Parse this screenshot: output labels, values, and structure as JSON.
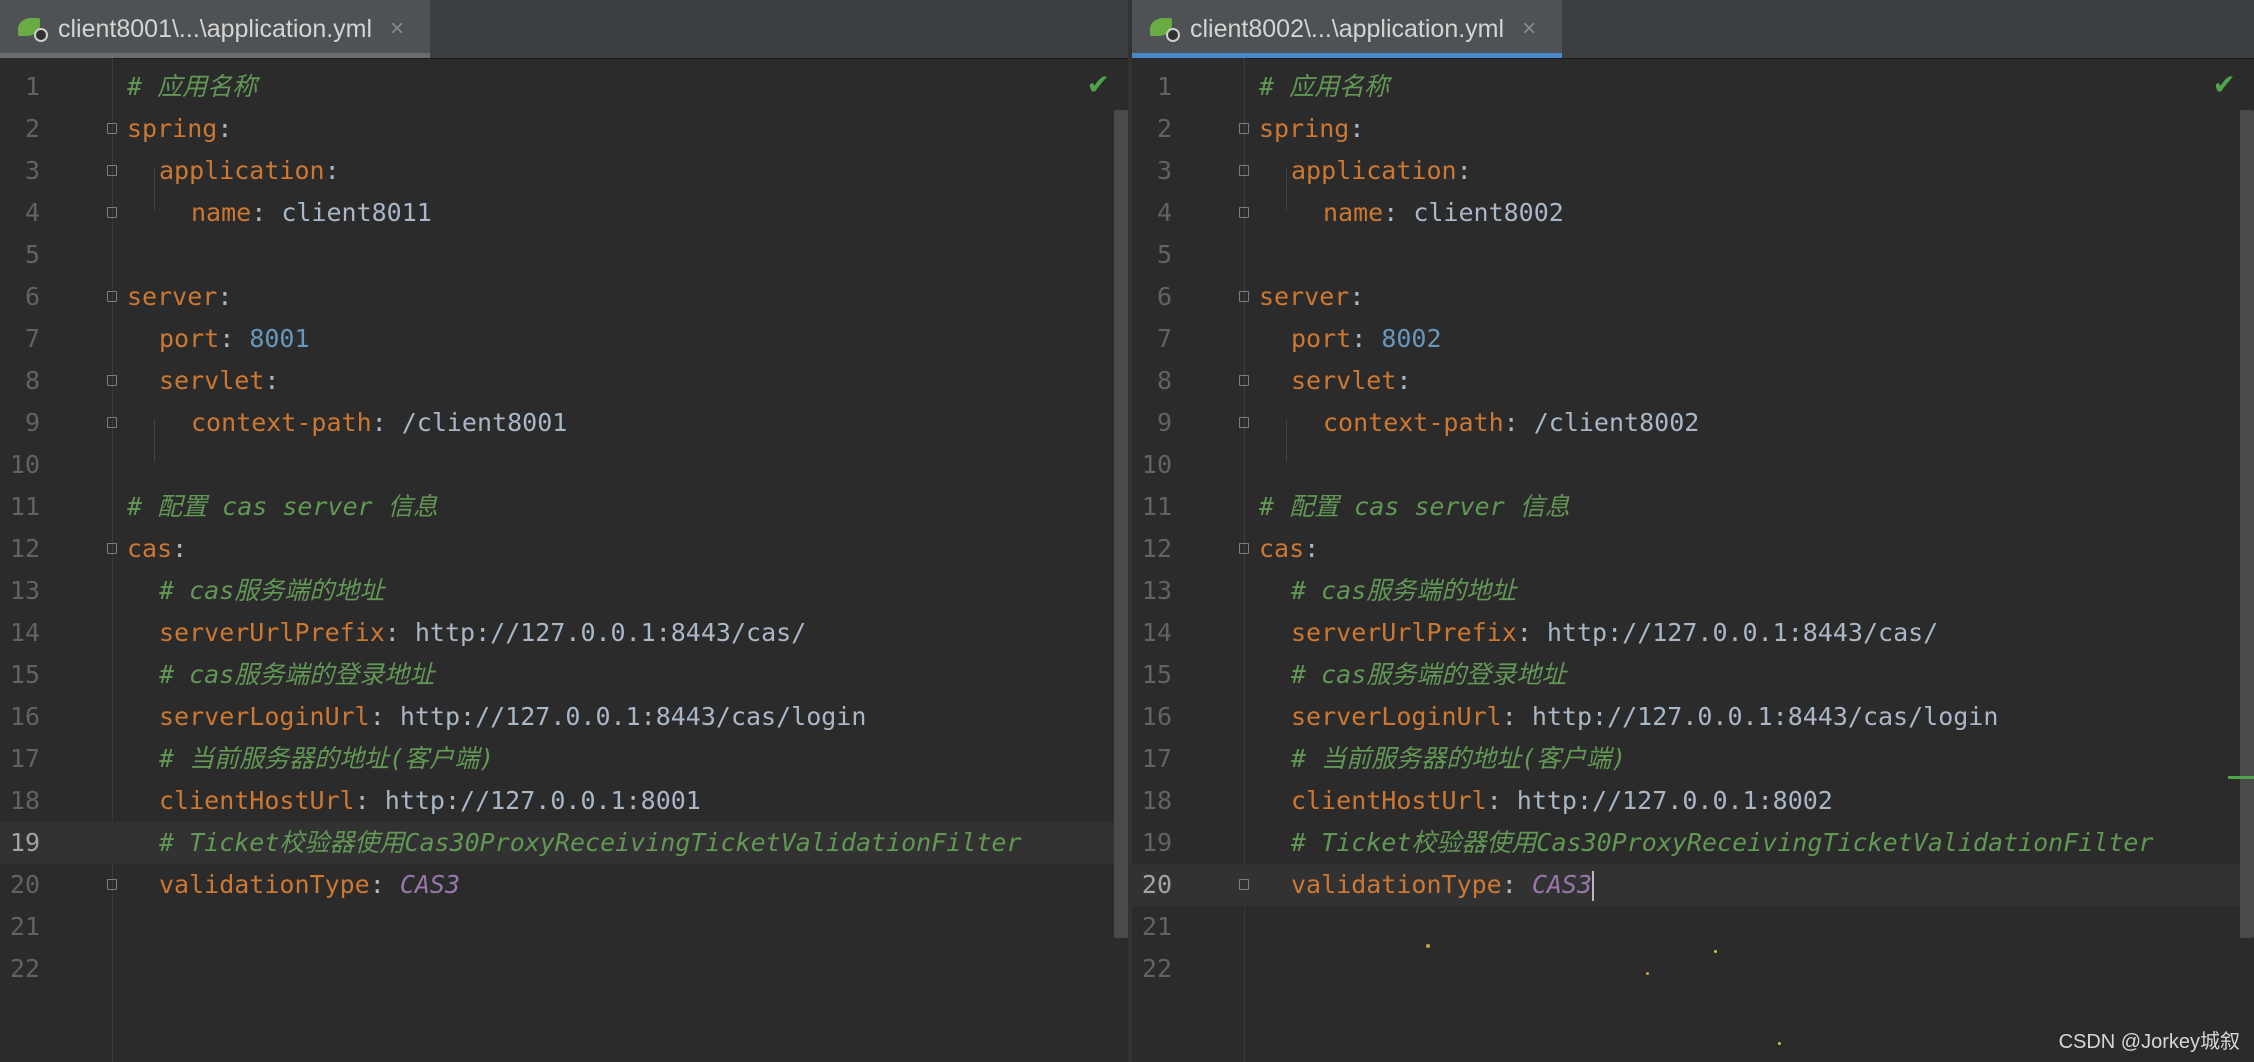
{
  "left": {
    "tab_label": "client8001\\...\\application.yml",
    "close_glyph": "×",
    "current_line": 19,
    "lines": [
      {
        "n": "1",
        "indent": 0,
        "parts": [
          {
            "c": "cm",
            "t": "# 应用名称"
          }
        ]
      },
      {
        "n": "2",
        "indent": 0,
        "parts": [
          {
            "c": "k",
            "t": "spring"
          },
          {
            "c": "p",
            "t": ":"
          }
        ]
      },
      {
        "n": "3",
        "indent": 1,
        "parts": [
          {
            "c": "k",
            "t": "application"
          },
          {
            "c": "p",
            "t": ":"
          }
        ]
      },
      {
        "n": "4",
        "indent": 2,
        "parts": [
          {
            "c": "k",
            "t": "name"
          },
          {
            "c": "p",
            "t": ": client8011"
          }
        ]
      },
      {
        "n": "5",
        "indent": 0,
        "parts": []
      },
      {
        "n": "6",
        "indent": 0,
        "parts": [
          {
            "c": "k",
            "t": "server"
          },
          {
            "c": "p",
            "t": ":"
          }
        ]
      },
      {
        "n": "7",
        "indent": 1,
        "parts": [
          {
            "c": "k",
            "t": "port"
          },
          {
            "c": "p",
            "t": ": "
          },
          {
            "c": "num",
            "t": "8001"
          }
        ]
      },
      {
        "n": "8",
        "indent": 1,
        "parts": [
          {
            "c": "k",
            "t": "servlet"
          },
          {
            "c": "p",
            "t": ":"
          }
        ]
      },
      {
        "n": "9",
        "indent": 2,
        "parts": [
          {
            "c": "k",
            "t": "context-path"
          },
          {
            "c": "p",
            "t": ": /client8001"
          }
        ]
      },
      {
        "n": "10",
        "indent": 0,
        "parts": []
      },
      {
        "n": "11",
        "indent": 0,
        "parts": [
          {
            "c": "cm",
            "t": "# 配置 cas server 信息"
          }
        ]
      },
      {
        "n": "12",
        "indent": 0,
        "parts": [
          {
            "c": "k",
            "t": "cas"
          },
          {
            "c": "p",
            "t": ":"
          }
        ]
      },
      {
        "n": "13",
        "indent": 1,
        "parts": [
          {
            "c": "cm",
            "t": "# cas服务端的地址"
          }
        ]
      },
      {
        "n": "14",
        "indent": 1,
        "parts": [
          {
            "c": "k",
            "t": "serverUrlPrefix"
          },
          {
            "c": "p",
            "t": ": http://127.0.0.1:8443/cas/"
          }
        ]
      },
      {
        "n": "15",
        "indent": 1,
        "parts": [
          {
            "c": "cm",
            "t": "# cas服务端的登录地址"
          }
        ]
      },
      {
        "n": "16",
        "indent": 1,
        "parts": [
          {
            "c": "k",
            "t": "serverLoginUrl"
          },
          {
            "c": "p",
            "t": ": http://127.0.0.1:8443/cas/login"
          }
        ]
      },
      {
        "n": "17",
        "indent": 1,
        "parts": [
          {
            "c": "cm",
            "t": "# 当前服务器的地址(客户端)"
          }
        ]
      },
      {
        "n": "18",
        "indent": 1,
        "parts": [
          {
            "c": "k",
            "t": "clientHostUrl"
          },
          {
            "c": "p",
            "t": ": http://127.0.0.1:8001"
          }
        ]
      },
      {
        "n": "19",
        "indent": 1,
        "parts": [
          {
            "c": "cm",
            "t": "# Ticket校验器使用Cas30ProxyReceivingTicketValidationFilter"
          }
        ]
      },
      {
        "n": "20",
        "indent": 1,
        "parts": [
          {
            "c": "k",
            "t": "validationType"
          },
          {
            "c": "p",
            "t": ": "
          },
          {
            "c": "en",
            "t": "CAS3"
          }
        ]
      },
      {
        "n": "21",
        "indent": 0,
        "parts": []
      },
      {
        "n": "22",
        "indent": 0,
        "parts": []
      }
    ]
  },
  "right": {
    "tab_label": "client8002\\...\\application.yml",
    "close_glyph": "×",
    "current_line": 20,
    "lines": [
      {
        "n": "1",
        "indent": 0,
        "parts": [
          {
            "c": "cm",
            "t": "# 应用名称"
          }
        ]
      },
      {
        "n": "2",
        "indent": 0,
        "parts": [
          {
            "c": "k",
            "t": "spring"
          },
          {
            "c": "p",
            "t": ":"
          }
        ]
      },
      {
        "n": "3",
        "indent": 1,
        "parts": [
          {
            "c": "k",
            "t": "application"
          },
          {
            "c": "p",
            "t": ":"
          }
        ]
      },
      {
        "n": "4",
        "indent": 2,
        "parts": [
          {
            "c": "k",
            "t": "name"
          },
          {
            "c": "p",
            "t": ": client8002"
          }
        ]
      },
      {
        "n": "5",
        "indent": 0,
        "parts": []
      },
      {
        "n": "6",
        "indent": 0,
        "parts": [
          {
            "c": "k",
            "t": "server"
          },
          {
            "c": "p",
            "t": ":"
          }
        ]
      },
      {
        "n": "7",
        "indent": 1,
        "parts": [
          {
            "c": "k",
            "t": "port"
          },
          {
            "c": "p",
            "t": ": "
          },
          {
            "c": "num",
            "t": "8002"
          }
        ]
      },
      {
        "n": "8",
        "indent": 1,
        "parts": [
          {
            "c": "k",
            "t": "servlet"
          },
          {
            "c": "p",
            "t": ":"
          }
        ]
      },
      {
        "n": "9",
        "indent": 2,
        "parts": [
          {
            "c": "k",
            "t": "context-path"
          },
          {
            "c": "p",
            "t": ": /client8002"
          }
        ]
      },
      {
        "n": "10",
        "indent": 0,
        "parts": []
      },
      {
        "n": "11",
        "indent": 0,
        "parts": [
          {
            "c": "cm",
            "t": "# 配置 cas server 信息"
          }
        ]
      },
      {
        "n": "12",
        "indent": 0,
        "parts": [
          {
            "c": "k",
            "t": "cas"
          },
          {
            "c": "p",
            "t": ":"
          }
        ]
      },
      {
        "n": "13",
        "indent": 1,
        "parts": [
          {
            "c": "cm",
            "t": "# cas服务端的地址"
          }
        ]
      },
      {
        "n": "14",
        "indent": 1,
        "parts": [
          {
            "c": "k",
            "t": "serverUrlPrefix"
          },
          {
            "c": "p",
            "t": ": http://127.0.0.1:8443/cas/"
          }
        ]
      },
      {
        "n": "15",
        "indent": 1,
        "parts": [
          {
            "c": "cm",
            "t": "# cas服务端的登录地址"
          }
        ]
      },
      {
        "n": "16",
        "indent": 1,
        "parts": [
          {
            "c": "k",
            "t": "serverLoginUrl"
          },
          {
            "c": "p",
            "t": ": http://127.0.0.1:8443/cas/login"
          }
        ]
      },
      {
        "n": "17",
        "indent": 1,
        "parts": [
          {
            "c": "cm",
            "t": "# 当前服务器的地址(客户端)"
          }
        ]
      },
      {
        "n": "18",
        "indent": 1,
        "parts": [
          {
            "c": "k",
            "t": "clientHostUrl"
          },
          {
            "c": "p",
            "t": ": http://127.0.0.1:8002"
          }
        ]
      },
      {
        "n": "19",
        "indent": 1,
        "parts": [
          {
            "c": "cm",
            "t": "# Ticket校验器使用Cas30ProxyReceivingTicketValidationFilter"
          }
        ]
      },
      {
        "n": "20",
        "indent": 1,
        "parts": [
          {
            "c": "k",
            "t": "validationType"
          },
          {
            "c": "p",
            "t": ": "
          },
          {
            "c": "en",
            "t": "CAS3"
          }
        ]
      },
      {
        "n": "21",
        "indent": 0,
        "parts": []
      },
      {
        "n": "22",
        "indent": 0,
        "parts": []
      }
    ]
  },
  "inspection_icon": "check-icon",
  "watermark": "CSDN @Jorkey城叙",
  "colors": {
    "keyword": "#cc7832",
    "comment": "#629755",
    "number": "#6897bb",
    "enum": "#9876aa",
    "active_tab_underline": "#4a88c7"
  }
}
